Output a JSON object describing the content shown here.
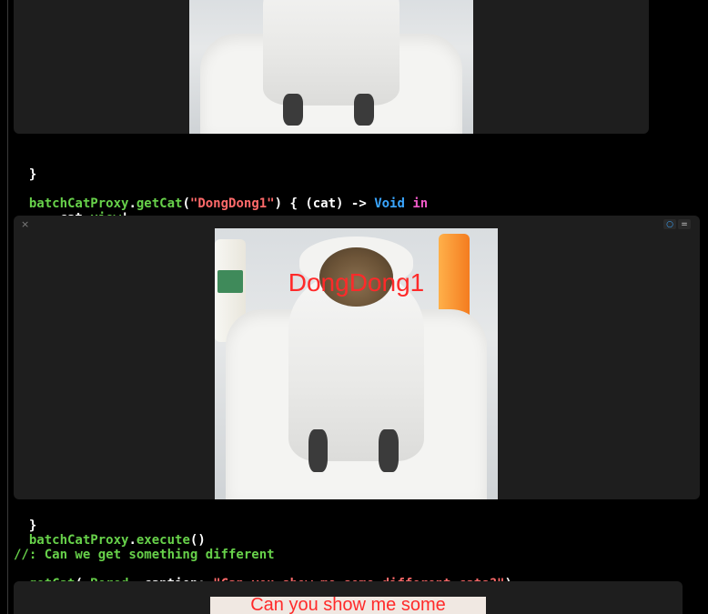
{
  "code": {
    "closing_brace_1": "}",
    "line_getcat": {
      "object": "batchCatProxy",
      "dot": ".",
      "method": "getCat",
      "open_paren": "(",
      "string_arg": "\"DongDong1\"",
      "after_arg": ") { (cat) -> ",
      "type_keyword": "Void",
      "space": " ",
      "in_keyword": "in"
    },
    "line_view": {
      "indent": "    ",
      "object": "cat",
      "dot": ".",
      "property": "view",
      "bang": "!"
    },
    "closing_brace_2": "}",
    "line_execute": {
      "object": "batchCatProxy",
      "dot": ".",
      "method": "execute",
      "parens": "()"
    },
    "comment_line": "//: Can we get something different",
    "line_getcat_bored": {
      "func": "getCat",
      "open_paren": "(",
      "enum_case": ".Bored",
      "label": ", caption: ",
      "string_arg": "\"Can you show me some different cats?\"",
      "close_paren": ")"
    }
  },
  "result_panels": [
    {
      "close_icon": "×",
      "controls": [
        "○",
        "="
      ],
      "caption": "DongDong1"
    },
    {
      "caption": "Can you show me some"
    }
  ],
  "top_panel": {
    "caption": ""
  },
  "colors": {
    "background": "#000000",
    "panel": "#1e1e1e",
    "keyword_green": "#67d14a",
    "string_red": "#ff6a6a",
    "type_blue": "#3aa6ff",
    "keyword_purple": "#f15ac9",
    "caption_red": "#ff2a2a"
  }
}
